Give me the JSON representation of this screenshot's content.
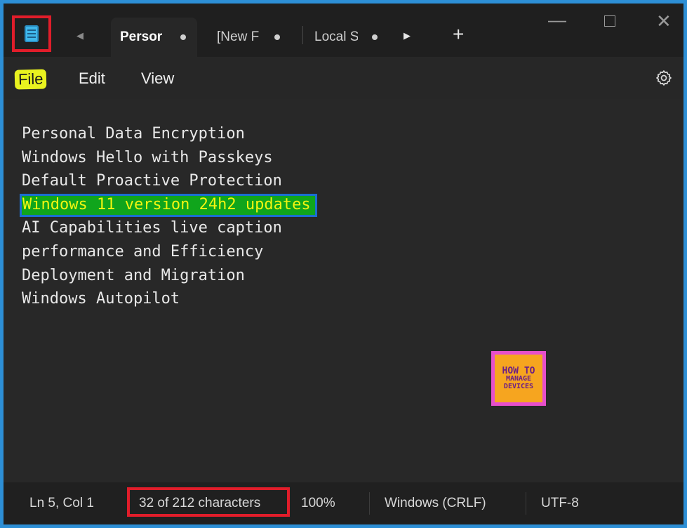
{
  "titlebar": {
    "app_icon": "notepad-icon",
    "tabs": [
      {
        "label": "Persor",
        "active": true
      },
      {
        "label": "[New F",
        "active": false
      },
      {
        "label": "Local S",
        "active": false
      }
    ],
    "new_tab_label": "+",
    "window_controls": [
      "minimize-icon",
      "maximize-icon",
      "close-icon"
    ]
  },
  "menu": {
    "items": [
      "File",
      "Edit",
      "View"
    ],
    "settings_icon": "gear-icon"
  },
  "editor": {
    "lines": [
      "Personal Data Encryption",
      "Windows Hello with Passkeys",
      "Default Proactive Protection",
      "Windows 11 version 24h2 updates",
      "AI Capabilities live caption",
      "performance and Efficiency",
      "Deployment and Migration",
      "Windows Autopilot"
    ],
    "selected_line_index": 3
  },
  "logo": {
    "line1": "HOW TO",
    "line2": "MANAGE",
    "line3": "DEVICES"
  },
  "statusbar": {
    "position": "Ln 5, Col 1",
    "char_count": "32 of 212 characters",
    "zoom": "100%",
    "line_ending": "Windows (CRLF)",
    "encoding": "UTF-8"
  },
  "colors": {
    "window_border": "#2d8fd6",
    "callout_red": "#e11d2a",
    "selection_green": "#10a51c",
    "selection_text_yellow": "#f1f511",
    "file_highlight_yellow": "#e9f21f"
  }
}
